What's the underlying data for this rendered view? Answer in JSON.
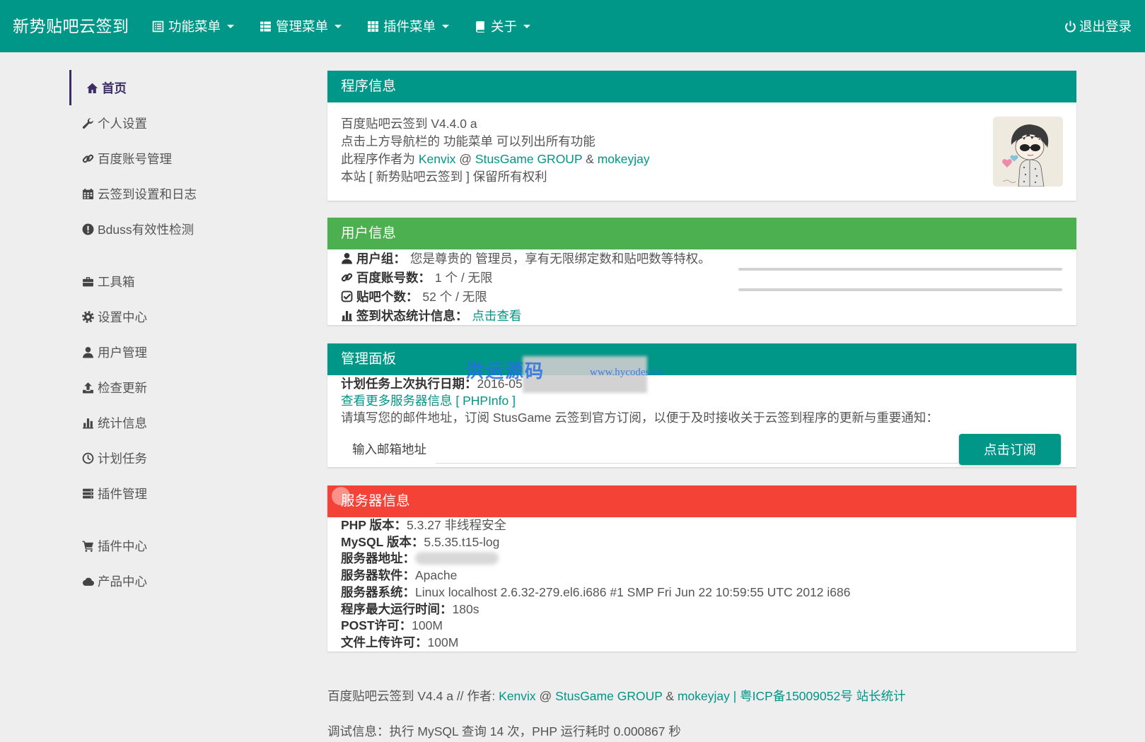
{
  "colors": {
    "primary": "#009688",
    "success": "#4caf50",
    "danger": "#f44336",
    "sidebar_active": "#3c2d66"
  },
  "navbar": {
    "brand": "新势贴吧云签到",
    "menus": [
      {
        "label": "功能菜单",
        "icon": "list-alt-icon"
      },
      {
        "label": "管理菜单",
        "icon": "th-list-icon"
      },
      {
        "label": "插件菜单",
        "icon": "th-icon"
      },
      {
        "label": "关于",
        "icon": "book-icon"
      }
    ],
    "logout": {
      "label": "退出登录",
      "icon": "power-icon"
    }
  },
  "sidebar": {
    "items": [
      {
        "label": "首页",
        "icon": "home-icon",
        "active": true
      },
      {
        "label": "个人设置",
        "icon": "wrench-icon"
      },
      {
        "label": "百度账号管理",
        "icon": "link-icon"
      },
      {
        "label": "云签到设置和日志",
        "icon": "calendar-icon"
      },
      {
        "label": "Bduss有效性检测",
        "icon": "exclamation-sign-icon"
      },
      {
        "label": "工具箱",
        "icon": "briefcase-icon"
      },
      {
        "label": "设置中心",
        "icon": "cog-icon"
      },
      {
        "label": "用户管理",
        "icon": "user-icon"
      },
      {
        "label": "检查更新",
        "icon": "upload-icon"
      },
      {
        "label": "统计信息",
        "icon": "stats-icon"
      },
      {
        "label": "计划任务",
        "icon": "clock-icon"
      },
      {
        "label": "插件管理",
        "icon": "server-icon"
      },
      {
        "label": "插件中心",
        "icon": "shopping-cart-icon"
      },
      {
        "label": "产品中心",
        "icon": "cloud-icon"
      }
    ]
  },
  "program_info": {
    "title": "程序信息",
    "version": "百度贴吧云签到 V4.4.0 a",
    "menu_hint": "点击上方导航栏的 功能菜单 可以列出所有功能",
    "author": {
      "prefix": "此程序作者为 ",
      "name1": "Kenvix",
      "sep1": " @ ",
      "name2": "StusGame GROUP",
      "sep2": " & ",
      "name3": "mokeyjay"
    },
    "rights": "本站 [ 新势贴吧云签到 ] 保留所有权利",
    "avatar_icon": "avatar-image"
  },
  "user_info": {
    "title": "用户信息",
    "group": {
      "label": "用户组：",
      "value": "您是尊贵的 管理员，享有无限绑定数和贴吧数等特权。",
      "icon": "user-icon"
    },
    "accounts": {
      "label": "百度账号数：",
      "value": "1 个 / 无限",
      "icon": "link-icon"
    },
    "tiebas": {
      "label": "贴吧个数：",
      "value": "52 个 / 无限",
      "icon": "check-square-icon"
    },
    "stats": {
      "label": "签到状态统计信息：",
      "link": "点击查看",
      "icon": "stats-icon"
    }
  },
  "admin_panel": {
    "title": "管理面板",
    "cron": {
      "label": "计划任务上次执行日期：",
      "value": "2016-05"
    },
    "phpinfo_link": "查看更多服务器信息 [ PHPInfo ]",
    "subscribe_text": "请填写您的邮件地址，订阅 StusGame 云签到官方订阅，以便于及时接收关于云签到程序的更新与重要通知：",
    "email_label": "输入邮箱地址",
    "email_value": "",
    "subscribe_button": "点击订阅"
  },
  "server_info": {
    "title": "服务器信息",
    "rows": [
      {
        "label": "PHP 版本：",
        "value": "5.3.27 非线程安全"
      },
      {
        "label": "MySQL 版本：",
        "value": "5.5.35.t15-log"
      },
      {
        "label": "服务器地址：",
        "value": ""
      },
      {
        "label": "服务器软件：",
        "value": "Apache"
      },
      {
        "label": "服务器系统：",
        "value": "Linux localhost 2.6.32-279.el6.i686 #1 SMP Fri Jun 22 10:59:55 UTC 2012 i686"
      },
      {
        "label": "程序最大运行时间：",
        "value": "180s"
      },
      {
        "label": "POST许可：",
        "value": "100M"
      },
      {
        "label": "文件上传许可：",
        "value": "100M"
      }
    ]
  },
  "watermark": {
    "text": "洪运源码",
    "url": "www.hycodes.cn"
  },
  "footer": {
    "prefix": "百度贴吧云签到 V4.4 a // 作者: ",
    "name1": "Kenvix",
    "sep1": " @ ",
    "name2": "StusGame GROUP",
    "sep2": " & ",
    "name3": "mokeyjay",
    "sep3": " | ",
    "icp": "粤ICP备15009052号",
    "stats_link": "站长统计",
    "debug": "调试信息：执行 MySQL 查询 14 次，PHP 运行耗时 0.000867 秒"
  }
}
